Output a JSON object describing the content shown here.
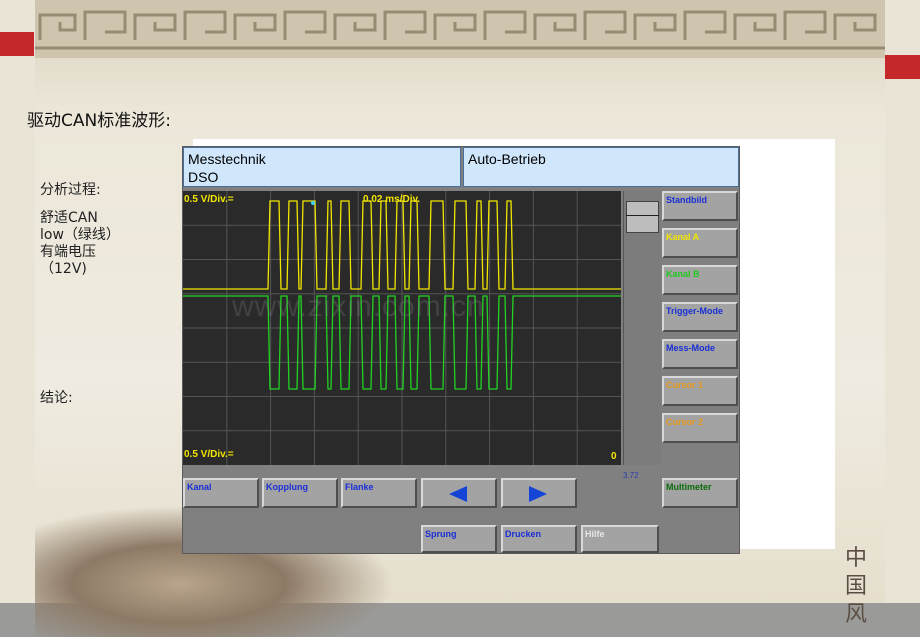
{
  "slide": {
    "heading": "驱动CAN标准波形:",
    "analysis_label": "分析过程:",
    "analysis_lines": [
      "舒适CAN",
      "low（绿线）",
      "有端电压",
      "（12V)"
    ],
    "conclusion_label": "结论:",
    "seal_text": "中国风"
  },
  "dso": {
    "header_left_line1": "Messtechnik",
    "header_left_line2": "DSO",
    "header_right": "Auto-Betrieb",
    "scale_top": "0.5 V/Div.=",
    "timebase": "0.02 ms/Div.",
    "scale_bottom": "0.5 V/Div.=",
    "zero_marker": "0",
    "scroll_value": "3.72",
    "side_buttons": [
      {
        "label": "Standbild",
        "color": "#1a2fd6"
      },
      {
        "label": "Kanal A",
        "color": "#f2e600"
      },
      {
        "label": "Kanal B",
        "color": "#1ec81e"
      },
      {
        "label": "Trigger-Mode",
        "color": "#1a2fd6"
      },
      {
        "label": "Mess-Mode",
        "color": "#1a2fd6"
      },
      {
        "label": "Cursor 1",
        "color": "#e89a1a"
      },
      {
        "label": "Cursor 2",
        "color": "#e89a1a"
      },
      {
        "label": "Multimeter",
        "color": "#0a6b0a"
      }
    ],
    "bottom_buttons": [
      {
        "label": "Kanal"
      },
      {
        "label": "Kopplung"
      },
      {
        "label": "Flanke"
      },
      {
        "label": "Sprung"
      },
      {
        "label": "Drucken"
      },
      {
        "label": "Hilfe"
      }
    ],
    "colors": {
      "screen_bg": "#2a2a2a",
      "trace_a": "#f2e600",
      "trace_b": "#22d322",
      "header_bg": "#cfe6fb",
      "button_text": "#1a2fd6"
    }
  },
  "watermark": "www.zixin.com.cn"
}
